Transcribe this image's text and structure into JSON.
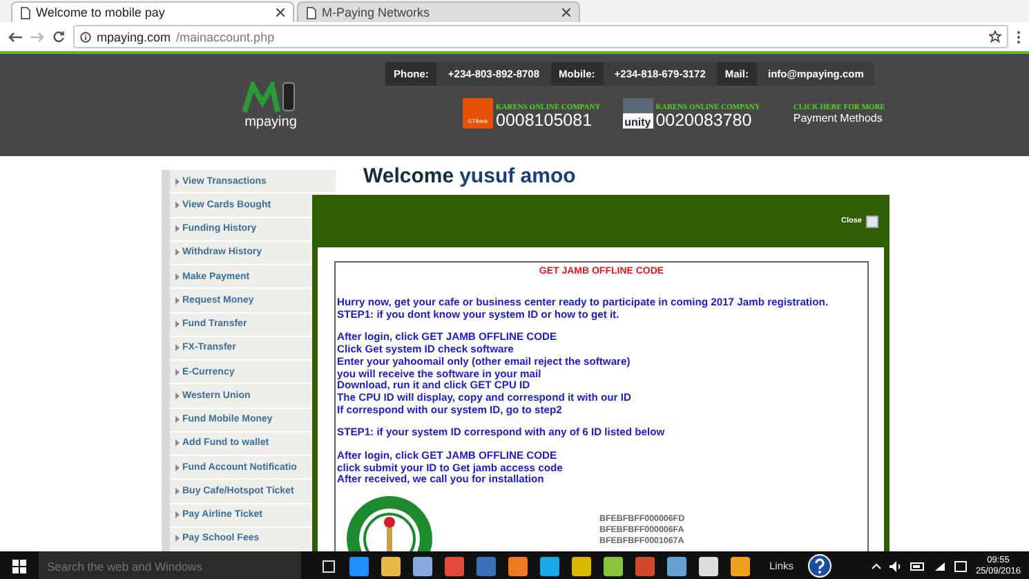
{
  "browser": {
    "tabs": [
      {
        "title": "Welcome to mobile pay",
        "selected": true
      },
      {
        "title": "M-Paying Networks",
        "selected": false
      }
    ],
    "url": {
      "host": "mpaying.com",
      "path": "/mainaccount.php"
    }
  },
  "header": {
    "logo_text": "mpaying",
    "contacts": [
      {
        "label": "Phone:",
        "value": "+234-803-892-8708"
      },
      {
        "label": "Mobile:",
        "value": "+234-818-679-3172"
      },
      {
        "label": "Mail:",
        "value": "info@mpaying.com"
      }
    ],
    "accounts": [
      {
        "bank": "GTBank",
        "company": "KARENS ONLINE COMPANY",
        "number": "0008105081",
        "kind": "gtbank"
      },
      {
        "bank": "unity",
        "company": "KARENS ONLINE COMPANY",
        "number": "0020083780",
        "kind": "unity"
      }
    ],
    "more_link": {
      "caption": "CLICK HERE FOR MORE",
      "label": "Payment Methods"
    }
  },
  "sidebar": {
    "items": [
      "View Transactions",
      "View Cards Bought",
      "Funding History",
      "Withdraw History",
      "Make Payment",
      "Request Money",
      "Fund Transfer",
      "FX-Transfer",
      "E-Currency",
      "Western Union",
      "Fund Mobile Money",
      "Add Fund to wallet",
      "Fund Account Notificatio",
      "Buy Cafe/Hotspot Ticket",
      "Pay Airline Ticket",
      "Pay School Fees"
    ]
  },
  "welcome": {
    "greeting": "Welcome",
    "name": "yusuf amoo"
  },
  "modal": {
    "close": "Close",
    "title": "GET JAMB OFFLINE CODE",
    "paragraphs": [
      [
        "Hurry now, get your cafe or business center ready to participate in coming 2017 Jamb registration.",
        "STEP1: if you dont know your system ID or how to get it."
      ],
      [
        "After login, click GET JAMB OFFLINE CODE",
        "Click Get system ID check software",
        "Enter your yahoomail only (other email reject the software)",
        "you will receive the software in your mail",
        "Download, run it and click GET CPU ID",
        "The CPU ID will display, copy and correspond it with our ID",
        "If correspond with our system ID, go to step2"
      ],
      [
        "STEP1: if your system ID correspond with any of 6 ID listed below"
      ],
      [
        "After login, click GET JAMB OFFLINE CODE",
        "click submit your ID to Get jamb access code",
        "After received, we call you for installation"
      ]
    ],
    "ids": [
      "BFEBFBFF000006FD",
      "BFEBFBFF000006FA",
      "BFEBFBFF0001067A"
    ]
  },
  "taskbar": {
    "search_placeholder": "Search the web and Windows",
    "links": "Links",
    "time": "09:55",
    "date": "25/09/2016"
  }
}
